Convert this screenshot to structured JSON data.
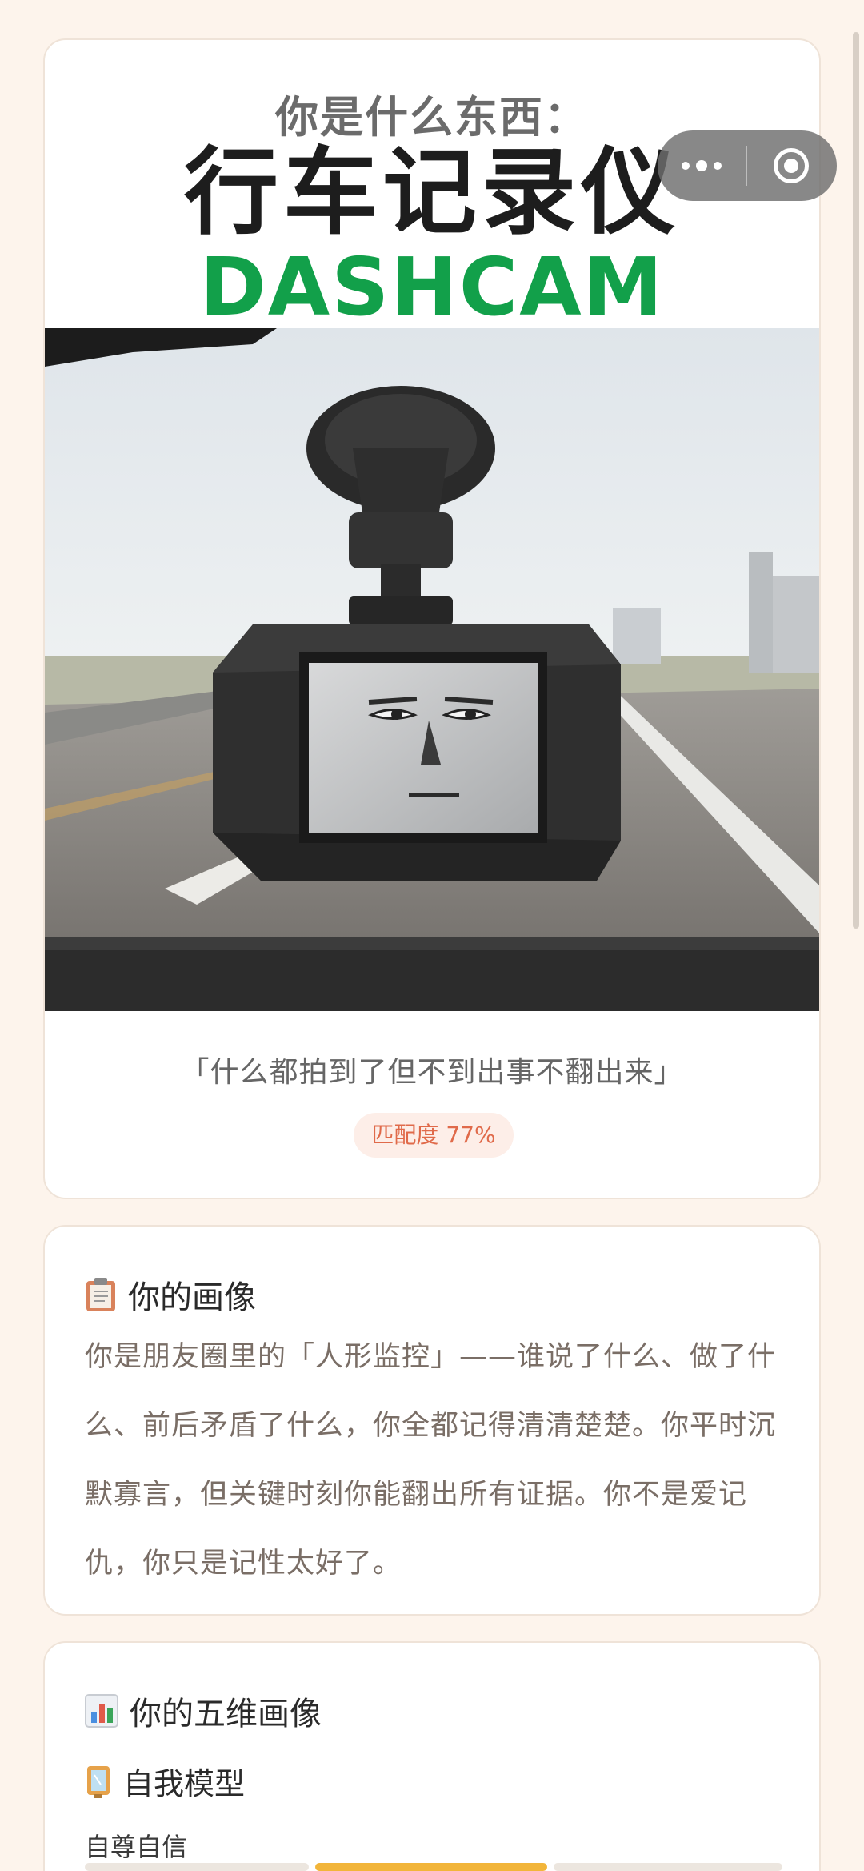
{
  "hero": {
    "pre_title": "你是什么东西：",
    "title": "行车记录仪",
    "title_en": "DASHCAM",
    "quote": "「什么都拍到了但不到出事不翻出来」",
    "match": "匹配度 77%"
  },
  "portrait": {
    "icon": "clipboard-icon",
    "heading": "你的画像",
    "body": "你是朋友圈里的「人形监控」——谁说了什么、做了什么、前后矛盾了什么，你全都记得清清楚楚。你平时沉默寡言，但关键时刻你能翻出所有证据。你不是爱记仇，你只是记性太好了。"
  },
  "dimensions": {
    "icon": "bar-chart-icon",
    "heading": "你的五维画像",
    "sub_icon": "mirror-icon",
    "sub_heading": "自我模型",
    "first_item": "自尊自信"
  },
  "capsule": {
    "more_icon": "more-dots-icon",
    "close_icon": "close-target-icon"
  },
  "colors": {
    "accent_green": "#12a04a",
    "match_text": "#e06a4a",
    "match_bg": "#fdeee8",
    "page_bg": "#fdf4ec"
  }
}
